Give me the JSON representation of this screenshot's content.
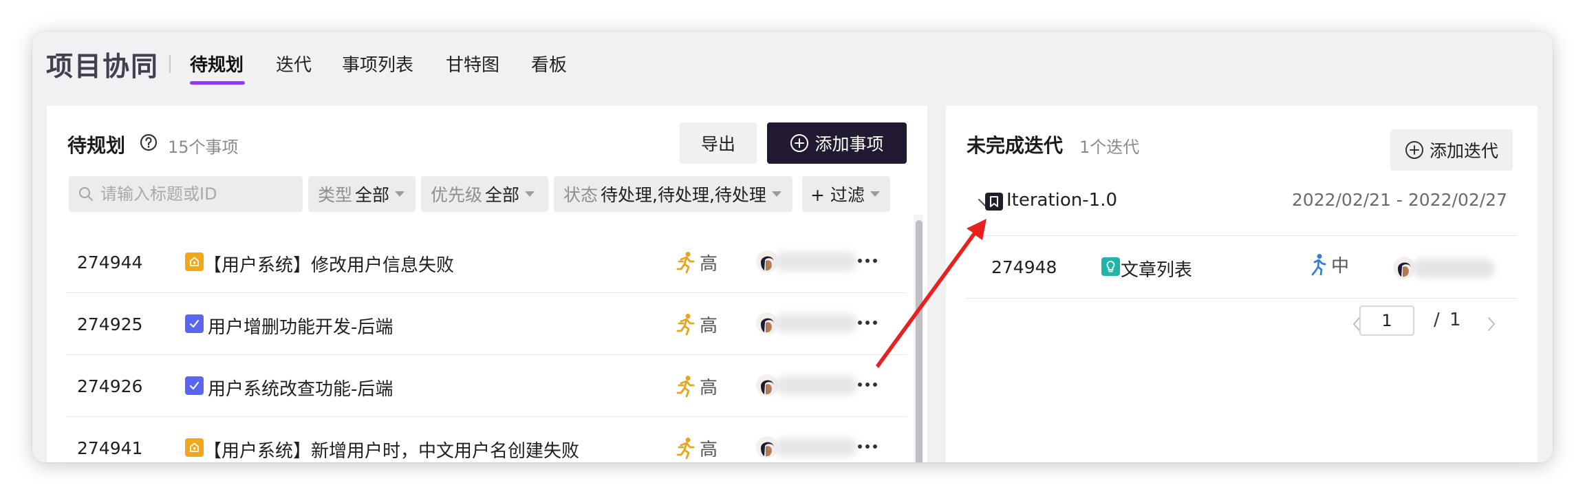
{
  "app": {
    "title": "项目协同",
    "tabs": [
      {
        "label": "待规划",
        "active": true
      },
      {
        "label": "迭代",
        "active": false
      },
      {
        "label": "事项列表",
        "active": false
      },
      {
        "label": "甘特图",
        "active": false
      },
      {
        "label": "看板",
        "active": false
      }
    ],
    "accent_color": "#8a3fe6"
  },
  "backlog": {
    "title": "待规划",
    "count_label": "15个事项",
    "export_label": "导出",
    "add_item_label": "添加事项",
    "search_placeholder": "请输入标题或ID",
    "filters": {
      "type": {
        "label": "类型",
        "value": "全部"
      },
      "priority": {
        "label": "优先级",
        "value": "全部"
      },
      "status": {
        "label": "状态",
        "value": "待处理,待处理,待处理"
      },
      "more": {
        "label": "+ 过滤"
      }
    },
    "items": [
      {
        "id": "274944",
        "type": "bug",
        "type_icon": "bug-icon",
        "type_color": "#f0a81a",
        "title": "【用户系统】修改用户信息失败",
        "priority": "高",
        "priority_icon": "runner-fast-icon",
        "priority_color": "#e8a41a"
      },
      {
        "id": "274925",
        "type": "task",
        "type_icon": "checkbox-task-icon",
        "type_color": "#5a66f0",
        "title": "用户增删功能开发-后端",
        "priority": "高",
        "priority_icon": "runner-fast-icon",
        "priority_color": "#e8a41a"
      },
      {
        "id": "274926",
        "type": "task",
        "type_icon": "checkbox-task-icon",
        "type_color": "#5a66f0",
        "title": "用户系统改查功能-后端",
        "priority": "高",
        "priority_icon": "runner-fast-icon",
        "priority_color": "#e8a41a"
      },
      {
        "id": "274941",
        "type": "bug",
        "type_icon": "bug-icon",
        "type_color": "#f0a81a",
        "title": "【用户系统】新增用户时，中文用户名创建失败",
        "priority": "高",
        "priority_icon": "runner-fast-icon",
        "priority_color": "#e8a41a"
      }
    ]
  },
  "iterations": {
    "title": "未完成迭代",
    "count_label": "1个迭代",
    "add_label": "添加迭代",
    "iteration": {
      "name": "Iteration-1.0",
      "date_range": "2022/02/21 - 2022/02/27",
      "items": [
        {
          "id": "274948",
          "type_icon": "story-icon",
          "type_color": "#1fb5a8",
          "title": "文章列表",
          "priority": "中",
          "priority_icon": "runner-medium-icon",
          "priority_color": "#2f7fe8"
        }
      ]
    },
    "pagination": {
      "current": "1",
      "separator": "/",
      "total": "1"
    }
  },
  "annotation": {
    "arrow_color": "#e82020"
  }
}
